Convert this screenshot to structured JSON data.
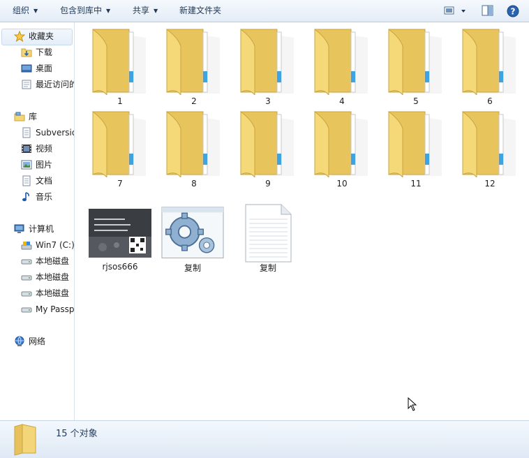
{
  "toolbar": {
    "organize": "组织",
    "include_in_library": "包含到库中",
    "share": "共享",
    "new_folder": "新建文件夹"
  },
  "nav": {
    "favorites": "收藏夹",
    "downloads": "下载",
    "desktop": "桌面",
    "recent": "最近访问的",
    "libraries": "库",
    "subversion": "Subversio",
    "videos": "视频",
    "pictures": "图片",
    "documents": "文档",
    "music": "音乐",
    "computer": "计算机",
    "drive_c": "Win7 (C:)",
    "disk1": "本地磁盘",
    "disk2": "本地磁盘",
    "disk3": "本地磁盘",
    "passport": "My Passp",
    "network": "网络"
  },
  "files": {
    "folders": [
      "1",
      "2",
      "3",
      "4",
      "5",
      "6",
      "7",
      "8",
      "9",
      "10",
      "11",
      "12"
    ],
    "image_name": "rjsos666",
    "exe_name": "复制",
    "txt_name": "复制"
  },
  "status": {
    "count": "15 个对象"
  },
  "icons": {
    "organize": "dropdown-caret-icon",
    "view": "view-options-icon",
    "preview": "preview-pane-icon",
    "help": "help-icon"
  },
  "colors": {
    "folder_yellow": "#f3d679",
    "selection_blue": "#cde2f7",
    "text": "#1e395b"
  }
}
